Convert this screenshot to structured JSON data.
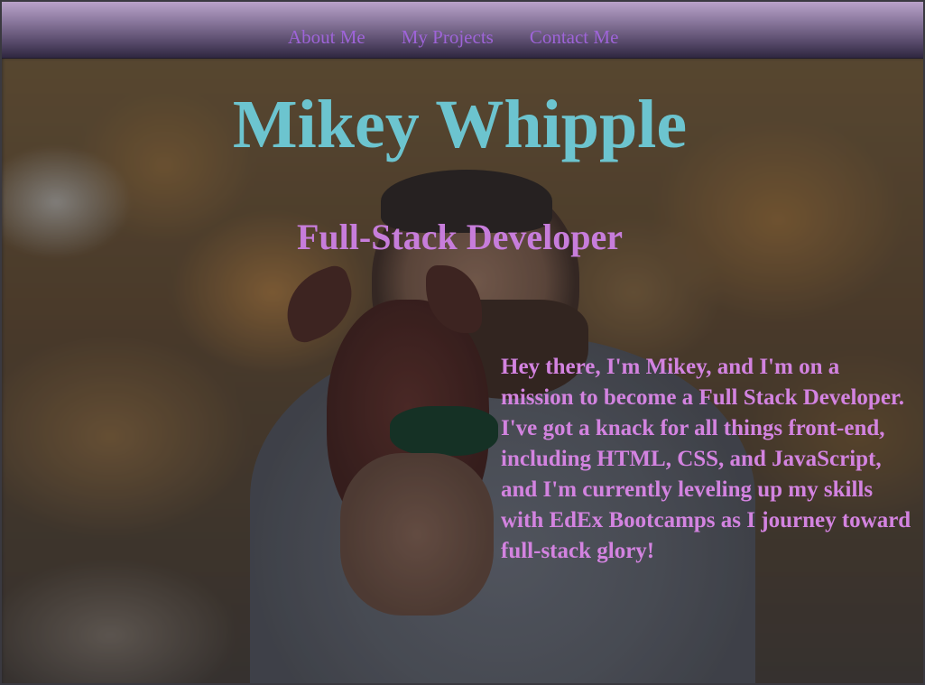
{
  "nav": {
    "items": [
      {
        "label": "About Me"
      },
      {
        "label": "My Projects"
      },
      {
        "label": "Contact Me"
      }
    ]
  },
  "hero": {
    "name": "Mikey Whipple",
    "role": "Full-Stack Developer",
    "bio": "Hey there, I'm Mikey, and I'm on a mission to become a Full Stack Developer. I've got a knack for all things front-end, including HTML, CSS, and JavaScript, and I'm currently leveling up my skills with EdEx Bootcamps as I journey toward full-stack glory!"
  },
  "colors": {
    "name": "#6cc4cf",
    "role": "#c77ddb",
    "bio": "#d383e0",
    "nav_link": "#9e64d8",
    "nav_bar_top": "#b9a2c9",
    "nav_bar_bottom": "#2f2740"
  }
}
